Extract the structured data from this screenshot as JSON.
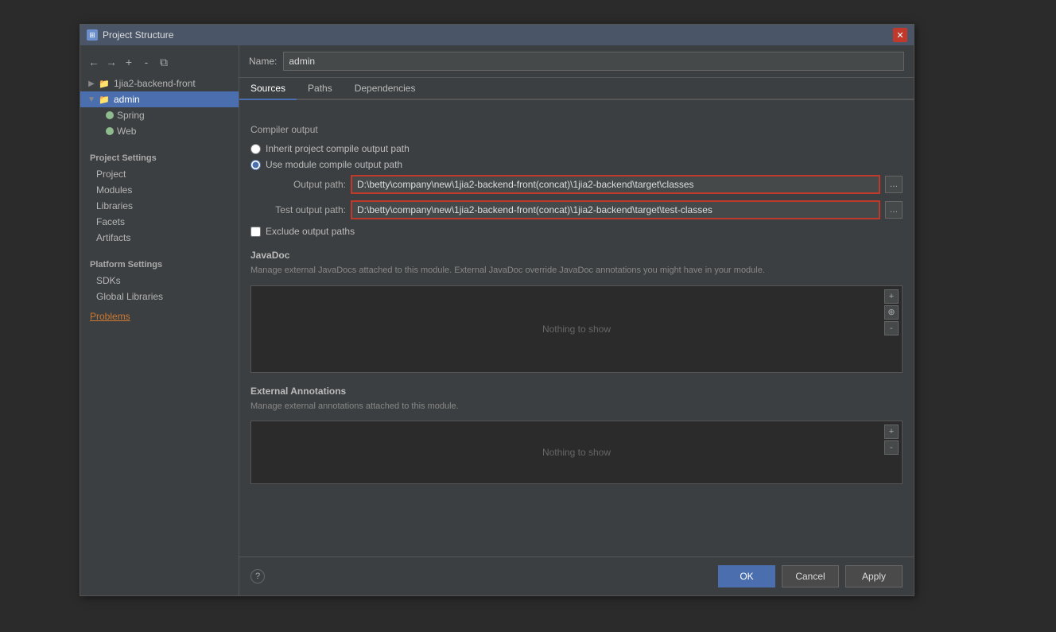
{
  "dialog": {
    "title": "Project Structure",
    "titleIcon": "⊞"
  },
  "sidebar": {
    "toolbar": {
      "back_label": "←",
      "forward_label": "→",
      "add_label": "+",
      "remove_label": "-",
      "copy_label": "⧉"
    },
    "project_settings_label": "Project Settings",
    "project_items": [
      {
        "label": "Project",
        "indent": false
      },
      {
        "label": "Modules",
        "indent": false
      },
      {
        "label": "Libraries",
        "indent": false
      },
      {
        "label": "Facets",
        "indent": false
      },
      {
        "label": "Artifacts",
        "indent": false
      }
    ],
    "platform_settings_label": "Platform Settings",
    "platform_items": [
      {
        "label": "SDKs",
        "indent": false
      },
      {
        "label": "Global Libraries",
        "indent": false
      }
    ],
    "problems_label": "Problems",
    "tree": {
      "node1": "1jia2-backend-front",
      "node2": "admin",
      "node2_children": [
        {
          "label": "Spring"
        },
        {
          "label": "Web"
        }
      ]
    }
  },
  "main": {
    "name_label": "Name:",
    "name_value": "admin",
    "tabs": [
      {
        "label": "Sources",
        "active": true
      },
      {
        "label": "Paths",
        "active": false
      },
      {
        "label": "Dependencies",
        "active": false
      }
    ],
    "compiler_output": {
      "section_title": "Compiler output",
      "inherit_label": "Inherit project compile output path",
      "use_module_label": "Use module compile output path",
      "output_path_label": "Output path:",
      "output_path_value": "D:\\betty\\company\\new\\1jia2-backend-front(concat)\\1jia2-backend\\target\\classes",
      "test_output_label": "Test output path:",
      "test_output_value": "D:\\betty\\company\\new\\1jia2-backend-front(concat)\\1jia2-backend\\target\\test-classes",
      "exclude_label": "Exclude output paths"
    },
    "javadoc": {
      "section_title": "JavaDoc",
      "description": "Manage external JavaDocs attached to this module. External JavaDoc override JavaDoc annotations you might have in your module.",
      "empty_label": "Nothing to show",
      "add_btn": "+",
      "add_url_btn": "⊕",
      "remove_btn": "-"
    },
    "external_annotations": {
      "section_title": "External Annotations",
      "description": "Manage external annotations attached to this module.",
      "empty_label": "Nothing to show",
      "add_btn": "+",
      "remove_btn": "-"
    }
  },
  "footer": {
    "help_icon": "?",
    "ok_label": "OK",
    "cancel_label": "Cancel",
    "apply_label": "Apply"
  }
}
